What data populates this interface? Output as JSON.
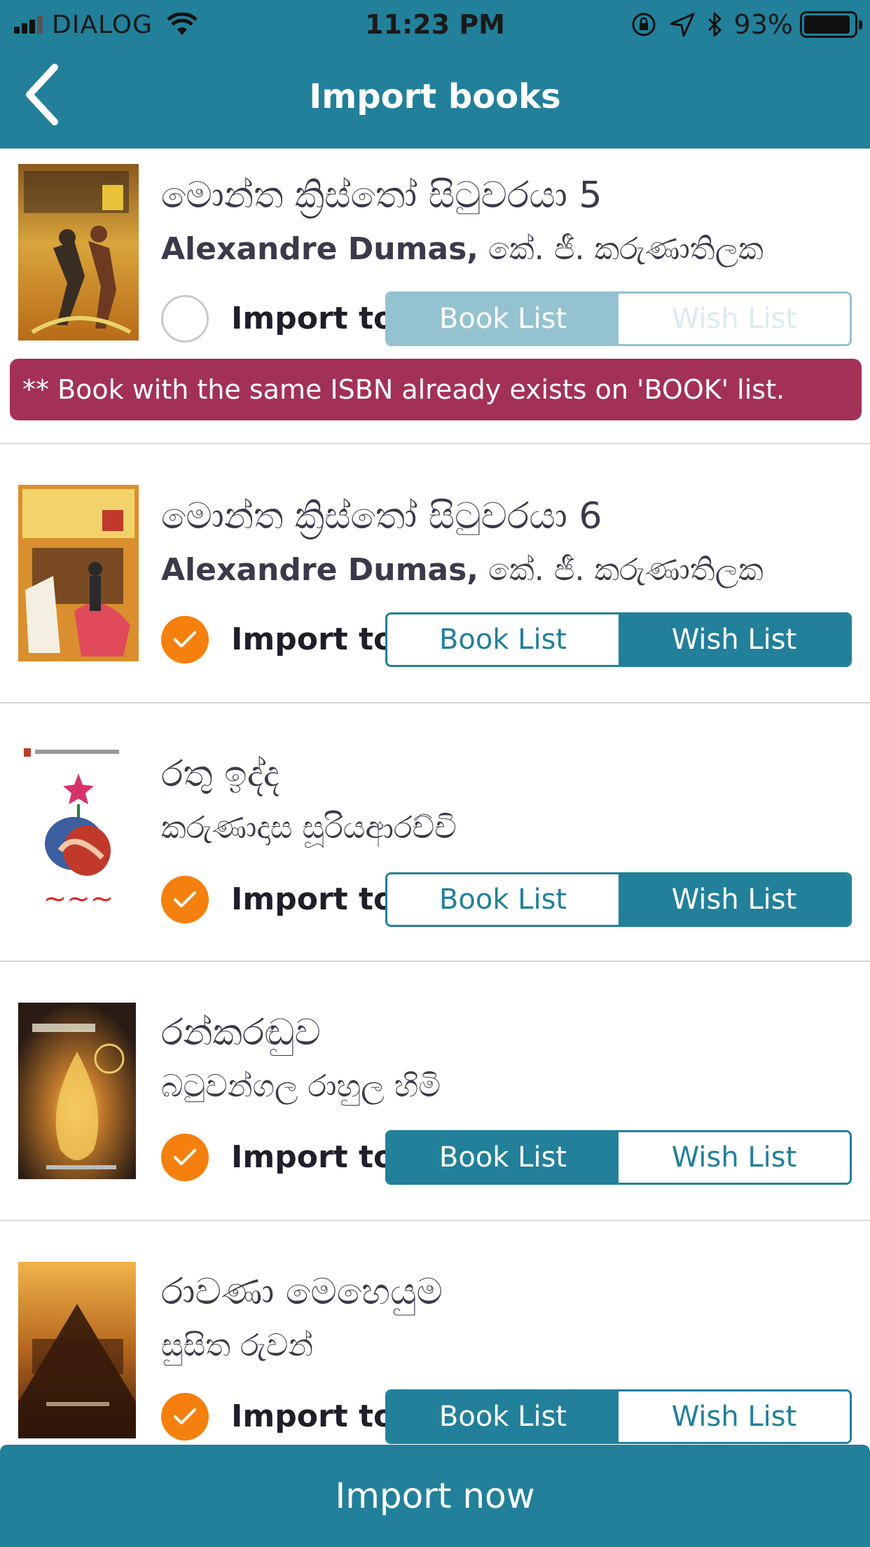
{
  "status_bar": {
    "carrier": "DIALOG",
    "time": "11:23 PM",
    "battery": "93%",
    "battery_level": 0.93,
    "icons": [
      "signal-icon",
      "wifi-icon",
      "rotation-lock-icon",
      "location-icon",
      "bluetooth-icon",
      "battery-icon"
    ]
  },
  "nav": {
    "title": "Import books",
    "back_icon": "chevron-left-icon"
  },
  "colors": {
    "primary": "#22809a",
    "primary_light": "#94c2d0",
    "check": "#f5800e",
    "warning": "#a33157"
  },
  "books": [
    {
      "title": "මොන්ත ක්‍රිස්තෝ සිටුවරයා 5",
      "author_latin": "Alexandre Dumas,",
      "author_sinhala": "කේ. ජී. කරුණාතිලක",
      "selected": false,
      "import_label": "Import to",
      "options": [
        "Book List",
        "Wish List"
      ],
      "active_option": "Book List",
      "disabled": true,
      "warning": "** Book with the same ISBN already exists on 'BOOK' list."
    },
    {
      "title": "මොන්ත ක්‍රිස්තෝ සිටුවරයා 6",
      "author_latin": "Alexandre Dumas,",
      "author_sinhala": "කේ. ජී. කරුණාතිලක",
      "selected": true,
      "import_label": "Import to",
      "options": [
        "Book List",
        "Wish List"
      ],
      "active_option": "Wish List",
      "disabled": false
    },
    {
      "title": "රතු ඉද්ද",
      "author_latin": "",
      "author_sinhala": "කරුණාදාස සූරියආරච්චි",
      "selected": true,
      "import_label": "Import to",
      "options": [
        "Book List",
        "Wish List"
      ],
      "active_option": "Wish List",
      "disabled": false
    },
    {
      "title": "රන්කරඬුව",
      "author_latin": "",
      "author_sinhala": "බටුවන්ගල රාහුල හිමි",
      "selected": true,
      "import_label": "Import to",
      "options": [
        "Book List",
        "Wish List"
      ],
      "active_option": "Book List",
      "disabled": false
    },
    {
      "title": "රාවණා මෙහෙයුම",
      "author_latin": "",
      "author_sinhala": "සුසිත රුවන්",
      "selected": true,
      "import_label": "Import to",
      "options": [
        "Book List",
        "Wish List"
      ],
      "active_option": "Book List",
      "disabled": false
    }
  ],
  "footer": {
    "import_now_label": "Import now"
  }
}
